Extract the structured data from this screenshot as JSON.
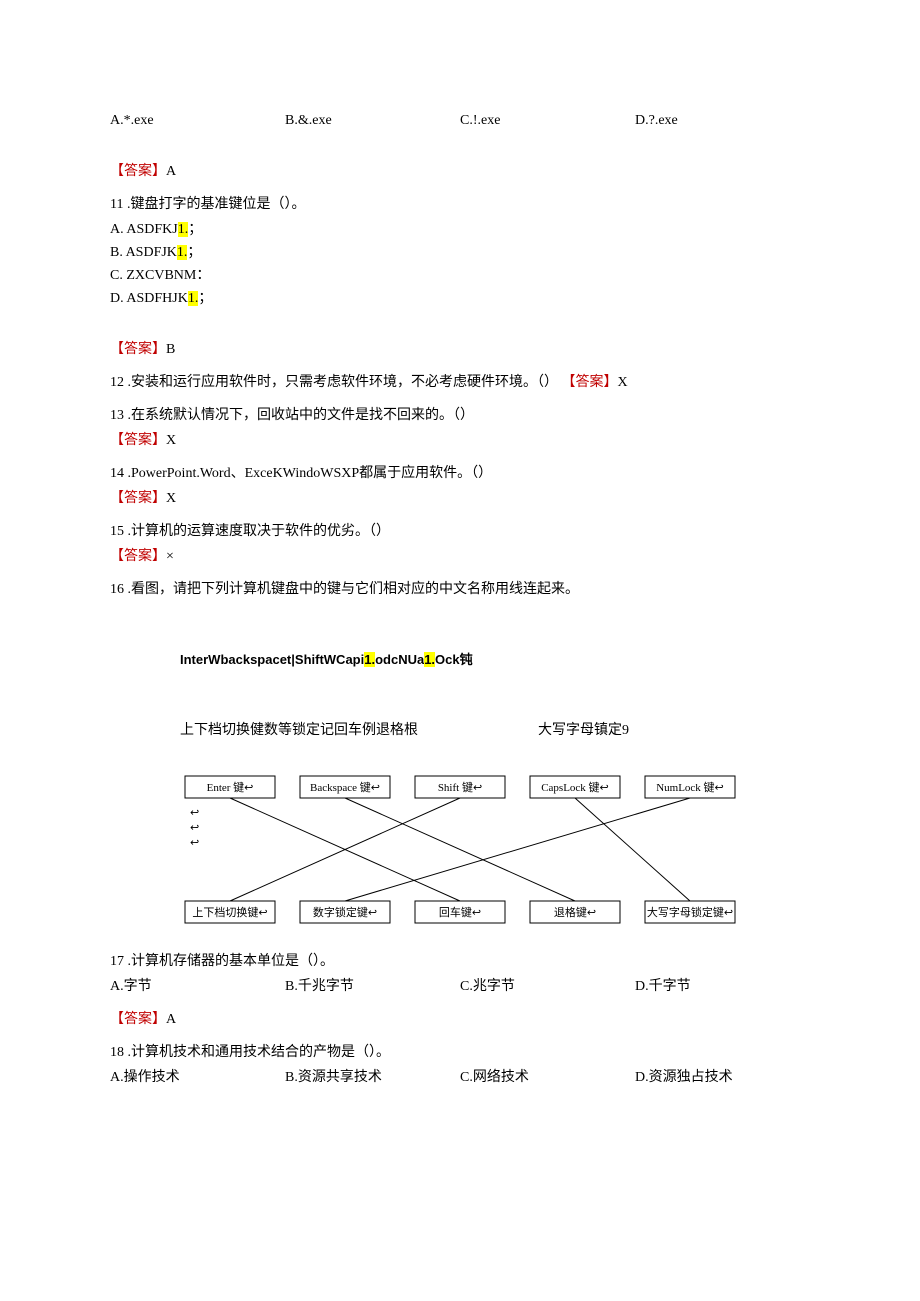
{
  "q10": {
    "options": {
      "a": "A.*.exe",
      "b": "B.&.exe",
      "c": "C.!.exe",
      "d": "D.?.exe"
    },
    "answer_label": "【答案】",
    "answer_value": "A"
  },
  "q11": {
    "stem": "11 .键盘打字的基准键位是（）。",
    "options": {
      "a_prefix": "A.   ASDFKJ",
      "a_hl": "1.",
      "a_suffix": "；",
      "b_prefix": "B.   ASDFJK",
      "b_hl": "1.",
      "b_suffix": "；",
      "c": "C.   ZXCVBNM：",
      "d_prefix": "D.   ASDFHJK",
      "d_hl": "1.",
      "d_suffix": "；"
    },
    "answer_label": "【答案】",
    "answer_value": "B"
  },
  "q12": {
    "stem": "12 .安装和运行应用软件时，只需考虑软件环境，不必考虑硬件环境。（）",
    "answer_label": "【答案】",
    "answer_value": "X"
  },
  "q13": {
    "stem": "13 .在系统默认情况下，回收站中的文件是找不回来的。（）",
    "answer_label": "【答案】",
    "answer_value": "X"
  },
  "q14": {
    "stem": "14 .PowerPoint.Word、ExceKWindoWSXP都属于应用软件。（）",
    "answer_label": "【答案】",
    "answer_value": "X"
  },
  "q15": {
    "stem": "15 .计算机的运算速度取决于软件的优劣。（）",
    "answer_label": "【答案】",
    "answer_value": "×"
  },
  "q16": {
    "stem": "16 .看图，请把下列计算机键盘中的键与它们相对应的中文名称用线连起来。",
    "key_row_1": "InterWbackspacet|ShiftWCapi",
    "key_row_h1": "1.",
    "key_row_2": "odcNUa",
    "key_row_h2": "1.",
    "key_row_3": "Ock钝",
    "labels_left": "上下档切换健数等锁定记回车例退格根",
    "labels_right": "大写字母镇定9",
    "diagram": {
      "top": [
        "Enter 键↩",
        "Backspace 键↩",
        "Shift 键↩",
        "CapsLock 键↩",
        "NumLock 键↩"
      ],
      "bottom": [
        "上下档切换键↩",
        "数字锁定键↩",
        "回车键↩",
        "退格键↩",
        "大写字母锁定键↩"
      ],
      "side_arrows": "↩"
    }
  },
  "q17": {
    "stem": "17 .计算机存储器的基本单位是（）。",
    "options": {
      "a": "A.字节",
      "b": "B.千兆字节",
      "c": "C.兆字节",
      "d": "D.千字节"
    },
    "answer_label": "【答案】",
    "answer_value": "A"
  },
  "q18": {
    "stem": "18 .计算机技术和通用技术结合的产物是（）。",
    "options": {
      "a": "A.操作技术",
      "b": "B.资源共享技术",
      "c": "C.网络技术",
      "d": "D.资源独占技术"
    }
  }
}
